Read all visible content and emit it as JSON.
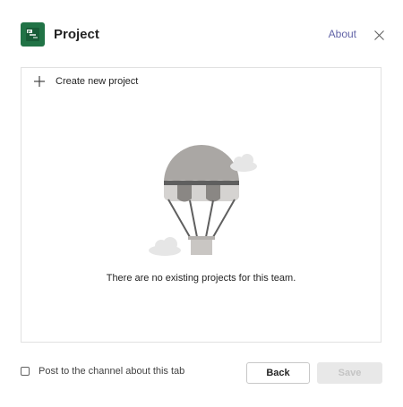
{
  "header": {
    "title": "Project",
    "about_label": "About"
  },
  "content": {
    "create_label": "Create new project",
    "empty_message": "There are no existing projects for this team."
  },
  "footer": {
    "checkbox_label": "Post to the channel about this tab",
    "checkbox_checked": false,
    "back_label": "Back",
    "save_label": "Save",
    "save_enabled": false
  },
  "colors": {
    "app_icon": "#217346",
    "link": "#6264a7",
    "disabled_button_bg": "#e8e8e8",
    "disabled_button_text": "#c4c4c4"
  },
  "icons": {
    "app": "project-app-icon",
    "close": "close-icon",
    "create": "plus-icon",
    "illustration": "hot-air-balloon-illustration"
  }
}
